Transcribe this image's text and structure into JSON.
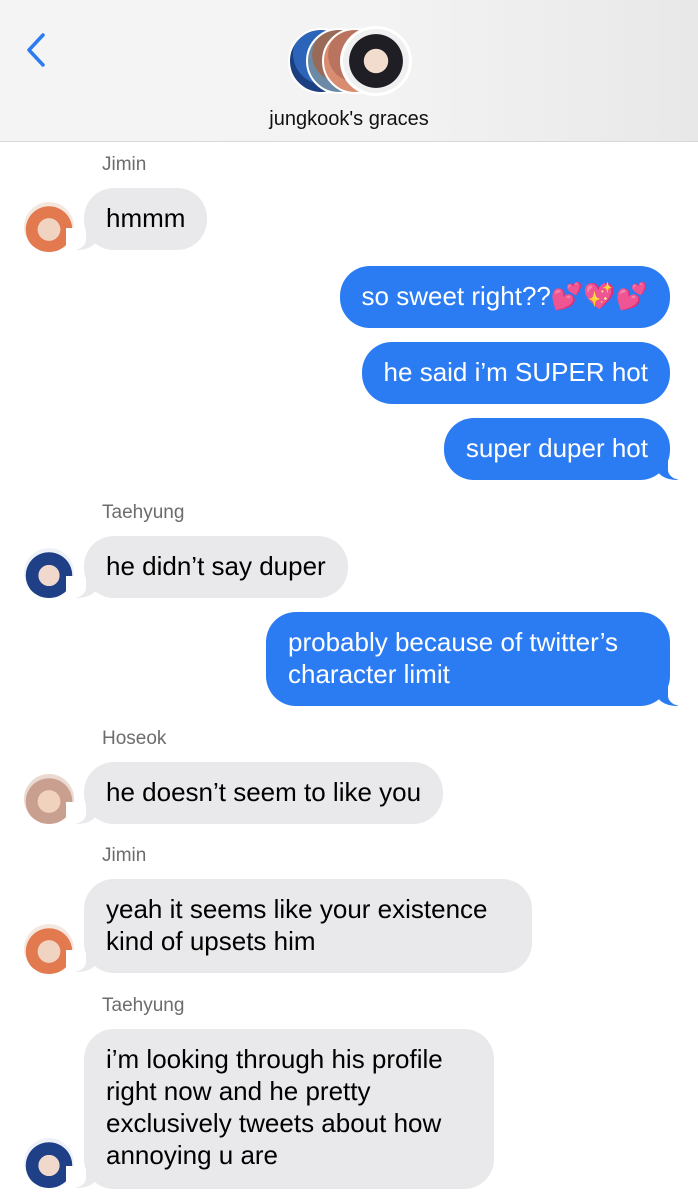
{
  "header": {
    "title": "jungkook's graces",
    "back_icon": "chevron-left-icon",
    "accent_color": "#2b7cf3"
  },
  "messages": [
    {
      "type": "sender",
      "text": "Jimin"
    },
    {
      "type": "incoming",
      "text": "hmmm",
      "avatar": "Jimin"
    },
    {
      "type": "outgoing",
      "text": "so sweet right??💕💖💕"
    },
    {
      "type": "outgoing",
      "text": "he said i’m SUPER hot"
    },
    {
      "type": "outgoing",
      "text": "super duper hot"
    },
    {
      "type": "sender",
      "text": "Taehyung"
    },
    {
      "type": "incoming",
      "text": "he didn’t say duper",
      "avatar": "Taehyung"
    },
    {
      "type": "outgoing",
      "text": "probably because of twitter’s character limit"
    },
    {
      "type": "sender",
      "text": "Hoseok"
    },
    {
      "type": "incoming",
      "text": "he doesn’t seem to like you",
      "avatar": "Hoseok"
    },
    {
      "type": "sender",
      "text": "Jimin"
    },
    {
      "type": "incoming",
      "text": "yeah it seems like your existence kind of upsets him",
      "avatar": "Jimin"
    },
    {
      "type": "sender",
      "text": "Taehyung"
    },
    {
      "type": "incoming",
      "text": "i’m looking through his profile right now and he pretty exclusively tweets about how annoying u are",
      "avatar": "Taehyung"
    }
  ],
  "colors": {
    "incoming_bubble": "#e9e9eb",
    "outgoing_bubble": "#2b7cf3",
    "sender_label": "#6c6c6c"
  }
}
